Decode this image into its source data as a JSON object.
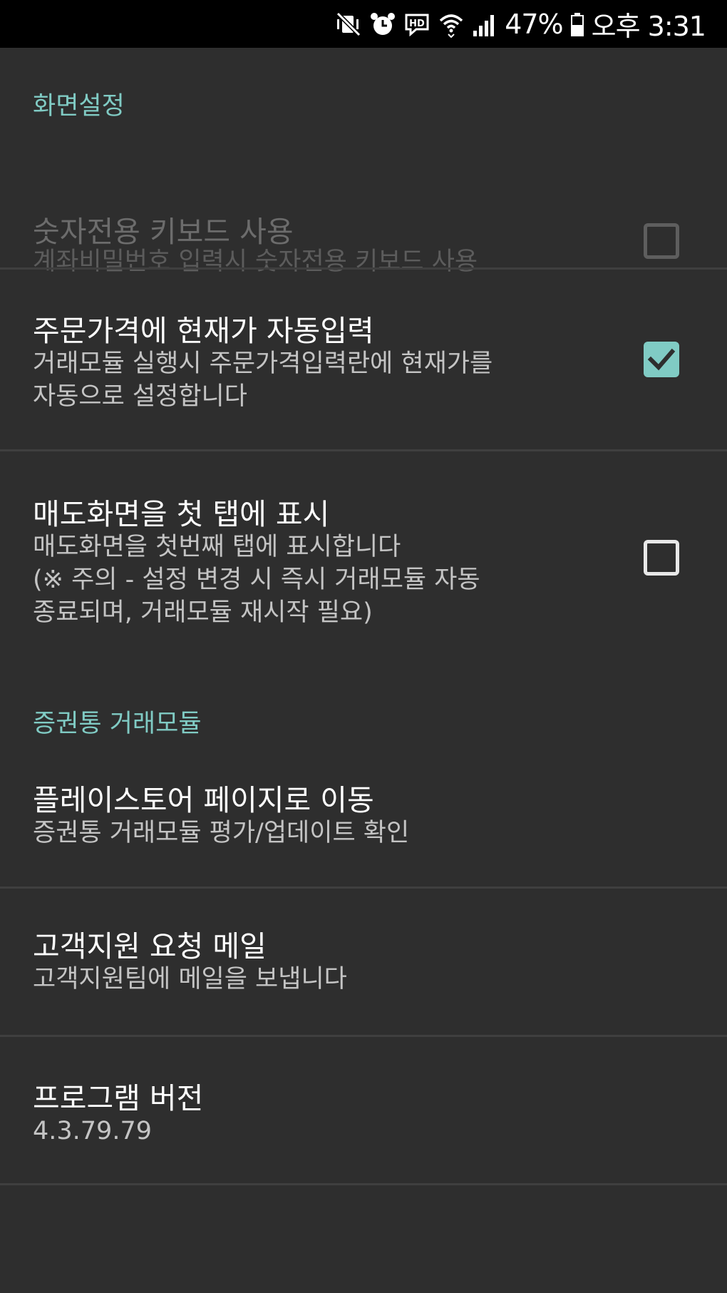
{
  "status_bar": {
    "battery": "47%",
    "time": "오후 3:31",
    "icons": [
      "mute-vibrate-icon",
      "alarm-icon",
      "hd-icon",
      "wifi-icon",
      "signal-icon",
      "battery-icon"
    ]
  },
  "colors": {
    "accent": "#80cbc4",
    "background": "#2e2e2e",
    "status_bar": "#000000"
  },
  "sections": {
    "display": {
      "header": "화면설정",
      "items": [
        {
          "title": "숫자전용 키보드 사용",
          "summary": "계좌비밀번호 입력시 숫자전용 키보드 사용",
          "checked": false,
          "enabled": false
        },
        {
          "title": "주문가격에 현재가 자동입력",
          "summary": "거래모듈 실행시 주문가격입력란에 현재가를\n자동으로 설정합니다",
          "checked": true,
          "enabled": true
        },
        {
          "title": "매도화면을 첫 탭에 표시",
          "summary": "매도화면을 첫번째 탭에 표시합니다\n(※ 주의 - 설정 변경 시 즉시  거래모듈 자동\n종료되며, 거래모듈 재시작 필요)",
          "checked": false,
          "enabled": true
        }
      ]
    },
    "module": {
      "header": "증권통 거래모듈",
      "items": [
        {
          "title": "플레이스토어 페이지로 이동",
          "summary": "증권통 거래모듈 평가/업데이트 확인"
        },
        {
          "title": "고객지원 요청 메일",
          "summary": "고객지원팀에 메일을 보냅니다"
        },
        {
          "title": "프로그램 버전",
          "summary": "4.3.79.79"
        }
      ]
    }
  }
}
